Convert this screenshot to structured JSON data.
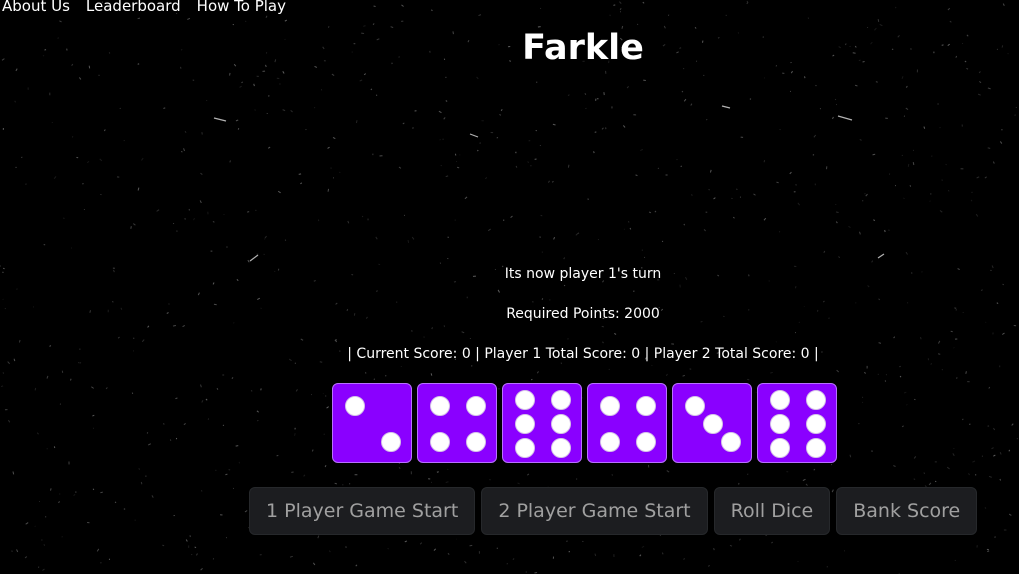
{
  "nav": {
    "about": "About Us",
    "leaderboard": "Leaderboard",
    "how_to_play": "How To Play"
  },
  "title": "Farkle",
  "status": {
    "turn": "Its now player 1's turn",
    "required": "Required Points: 2000",
    "scores": "| Current Score: 0 | Player 1 Total Score: 0 | Player 2 Total Score: 0 |"
  },
  "dice": {
    "values": [
      2,
      4,
      6,
      4,
      3,
      6
    ],
    "color": "#8a00ff",
    "pip_color": "#ffffff"
  },
  "buttons": {
    "one_player": "1 Player Game Start",
    "two_player": "2 Player Game Start",
    "roll": "Roll Dice",
    "bank": "Bank Score"
  }
}
